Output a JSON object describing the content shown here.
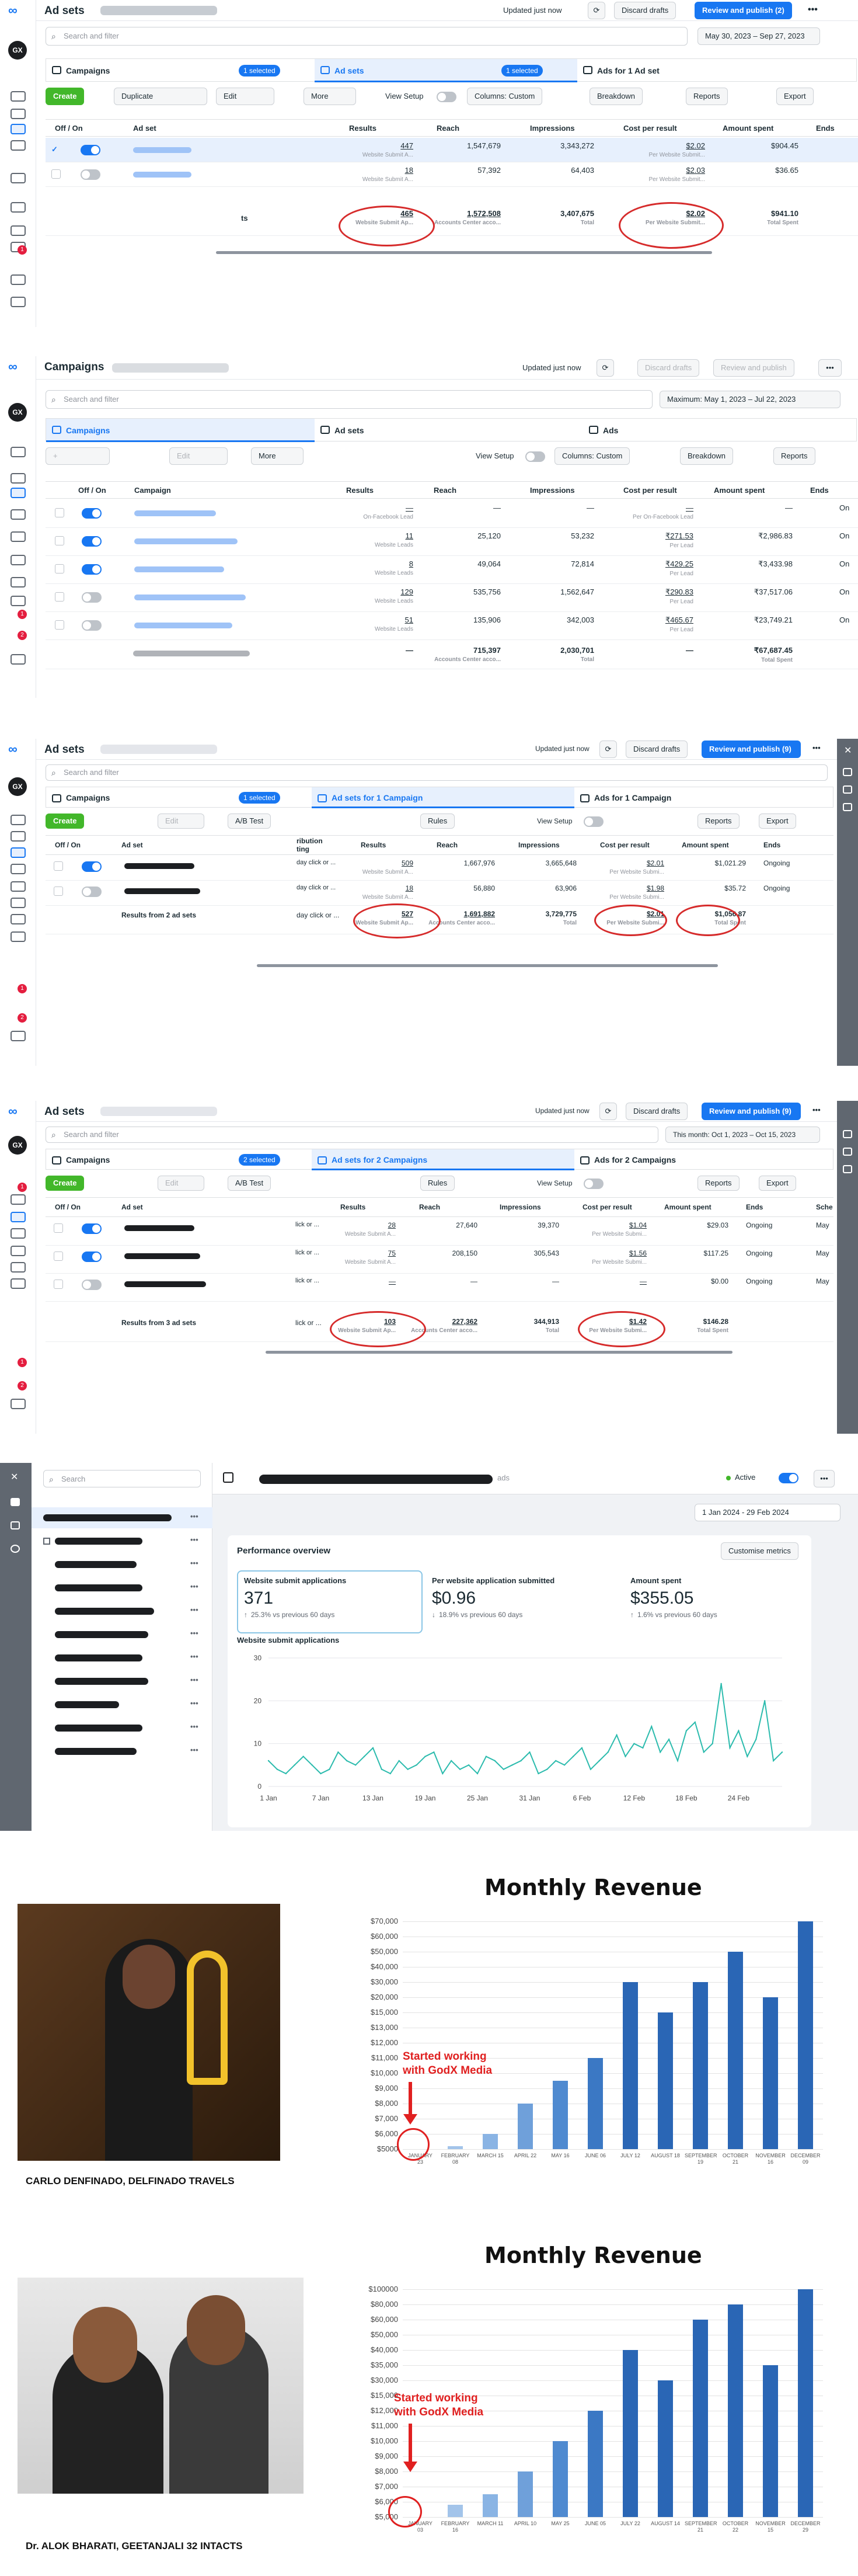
{
  "brand": {
    "accent": "#1877f2",
    "create_green": "#42b72a",
    "annotation_red": "#d62b2b",
    "chart_red": "#e02020"
  },
  "common": {
    "updated": "Updated just now",
    "discard": "Discard drafts",
    "search_placeholder": "Search and filter",
    "view_setup": "View Setup",
    "columns": "Columns: Custom",
    "breakdown": "Breakdown",
    "reports": "Reports",
    "export": "Export",
    "create": "Create",
    "edit": "Edit",
    "more": "More",
    "ab_test": "A/B Test",
    "rules": "Rules",
    "campaigns": "Campaigns",
    "gx": "GX",
    "header_offon": "Off / On",
    "header_adset": "Ad set",
    "header_campaign": "Campaign",
    "header_attribution": "ribution\nting",
    "header_results": "Results",
    "header_reach": "Reach",
    "header_impressions": "Impressions",
    "header_cpr": "Cost per result",
    "header_spent": "Amount spent",
    "header_ends": "Ends",
    "header_sche": "Sche"
  },
  "panel1": {
    "title": "Ad sets",
    "publish": "Review and publish (2)",
    "date": "May 30, 2023 – Sep 27, 2023",
    "selected": "1 selected",
    "tab_adsets": "Ad sets",
    "tab_ads": "Ads for 1 Ad set",
    "duplicate": "Duplicate",
    "rows": [
      {
        "results": "447",
        "results_sub": "Website Submit A...",
        "reach": "1,547,679",
        "impressions": "3,343,272",
        "cpr": "$2.02",
        "cpr_sub": "Per Website Submit...",
        "spent": "$904.45"
      },
      {
        "results": "18",
        "results_sub": "Website Submit A...",
        "reach": "57,392",
        "impressions": "64,403",
        "cpr": "$2.03",
        "cpr_sub": "Per Website Submit...",
        "spent": "$36.65"
      }
    ],
    "total": {
      "label": "ts",
      "results": "465",
      "results_sub": "Website Submit Ap...",
      "reach": "1,572,508",
      "reach_sub": "Accounts Center acco...",
      "impressions": "3,407,675",
      "impressions_sub": "Total",
      "cpr": "$2.02",
      "cpr_sub": "Per Website Submit...",
      "spent": "$941.10",
      "spent_sub": "Total Spent"
    }
  },
  "panel2": {
    "title": "Campaigns",
    "publish": "Review and publish",
    "date": "Maximum: May 1, 2023 – Jul 22, 2023",
    "tab_adsets": "Ad sets",
    "tab_ads": "Ads",
    "rows": [
      {
        "results": "—",
        "results_sub": "On-Facebook Lead",
        "reach": "—",
        "impressions": "—",
        "cpr": "—",
        "cpr_sub": "Per On-Facebook Lead",
        "spent": "—",
        "on": true
      },
      {
        "results": "11",
        "results_sub": "Website Leads",
        "reach": "25,120",
        "impressions": "53,232",
        "cpr": "₹271.53",
        "cpr_sub": "Per Lead",
        "spent": "₹2,986.83",
        "on": true
      },
      {
        "results": "8",
        "results_sub": "Website Leads",
        "reach": "49,064",
        "impressions": "72,814",
        "cpr": "₹429.25",
        "cpr_sub": "Per Lead",
        "spent": "₹3,433.98",
        "on": true
      },
      {
        "results": "129",
        "results_sub": "Website Leads",
        "reach": "535,756",
        "impressions": "1,562,647",
        "cpr": "₹290.83",
        "cpr_sub": "Per Lead",
        "spent": "₹37,517.06",
        "on": false
      },
      {
        "results": "51",
        "results_sub": "Website Leads",
        "reach": "135,906",
        "impressions": "342,003",
        "cpr": "₹465.67",
        "cpr_sub": "Per Lead",
        "spent": "₹23,749.21",
        "on": false
      }
    ],
    "ends_col": "On",
    "total": {
      "results": "—",
      "reach": "715,397",
      "reach_sub": "Accounts Center acco...",
      "impressions": "2,030,701",
      "impressions_sub": "Total",
      "cpr": "—",
      "spent": "₹67,687.45",
      "spent_sub": "Total Spent"
    }
  },
  "panel3": {
    "title": "Ad sets",
    "publish": "Review and publish (9)",
    "selected": "1 selected",
    "tab_adsets": "Ad sets for 1 Campaign",
    "tab_ads": "Ads for 1 Campaign",
    "rows": [
      {
        "attr": "day click or ...",
        "results": "509",
        "results_sub": "Website Submit A...",
        "reach": "1,667,976",
        "impressions": "3,665,648",
        "cpr": "$2.01",
        "cpr_sub": "Per Website Submi...",
        "spent": "$1,021.29",
        "ends": "Ongoing"
      },
      {
        "attr": "day click or ...",
        "results": "18",
        "results_sub": "Website Submit A...",
        "reach": "56,880",
        "impressions": "63,906",
        "cpr": "$1.98",
        "cpr_sub": "Per Website Submi...",
        "spent": "$35.72",
        "ends": "Ongoing"
      }
    ],
    "total": {
      "label": "Results from 2 ad sets",
      "attr": "day click or ...",
      "results": "527",
      "results_sub": "Website Submit Ap...",
      "reach": "1,691,882",
      "reach_sub": "Accounts Center acco...",
      "impressions": "3,729,775",
      "impressions_sub": "Total",
      "cpr": "$2.01",
      "cpr_sub": "Per Website Submi...",
      "spent": "$1,056.87",
      "spent_sub": "Total Spent"
    }
  },
  "panel4": {
    "title": "Ad sets",
    "publish": "Review and publish (9)",
    "date": "This month: Oct 1, 2023 – Oct 15, 2023",
    "selected": "2 selected",
    "tab_adsets": "Ad sets for 2 Campaigns",
    "tab_ads": "Ads for 2 Campaigns",
    "rows": [
      {
        "attr": "lick or ...",
        "results": "28",
        "results_sub": "Website Submit A...",
        "reach": "27,640",
        "impressions": "39,370",
        "cpr": "$1.04",
        "cpr_sub": "Per Website Submi...",
        "spent": "$29.03",
        "ends": "Ongoing",
        "sche": "May"
      },
      {
        "attr": "lick or ...",
        "results": "75",
        "results_sub": "Website Submit A...",
        "reach": "208,150",
        "impressions": "305,543",
        "cpr": "$1.56",
        "cpr_sub": "Per Website Submi...",
        "spent": "$117.25",
        "ends": "Ongoing",
        "sche": "May"
      },
      {
        "attr": "lick or ...",
        "results": "—",
        "results_sub": "",
        "reach": "—",
        "impressions": "—",
        "cpr": "—",
        "cpr_sub": "",
        "spent": "$0.00",
        "ends": "Ongoing",
        "sche": "May"
      }
    ],
    "total": {
      "label": "Results from 3 ad sets",
      "attr": "lick or ...",
      "results": "103",
      "results_sub": "Website Submit Ap...",
      "reach": "227,362",
      "reach_sub": "Accounts Center acco...",
      "impressions": "344,913",
      "impressions_sub": "Total",
      "cpr": "$1.42",
      "cpr_sub": "Per Website Submi...",
      "spent": "$146.28",
      "spent_sub": "Total Spent"
    }
  },
  "panel5": {
    "search": "Search",
    "status": "Active",
    "suffix": "ads",
    "date": "1 Jan 2024 - 29 Feb 2024",
    "perf_title": "Performance overview",
    "customise": "Customise metrics",
    "metrics": [
      {
        "label": "Website submit applications",
        "value": "371",
        "delta": "25.3% vs previous 60 days",
        "arrow": "↑"
      },
      {
        "label": "Per website application submitted",
        "value": "$0.96",
        "delta": "18.9% vs previous 60 days",
        "arrow": "↓"
      },
      {
        "label": "Amount spent",
        "value": "$355.05",
        "delta": "1.6% vs previous 60 days",
        "arrow": "↑"
      }
    ],
    "chart_title": "Website submit applications"
  },
  "revenue1": {
    "title": "Monthly Revenue",
    "caption": "CARLO DENFINADO, DELFINADO TRAVELS",
    "annotation": "Started working\nwith GodX Media"
  },
  "revenue2": {
    "title": "Monthly Revenue",
    "caption": "Dr. ALOK BHARATI, GEETANJALI 32 INTACTS",
    "annotation": "Started working\nwith GodX Media"
  },
  "chart_data": [
    {
      "type": "line",
      "title": "Website submit applications",
      "x": [
        "1 Jan",
        "2 Jan",
        "3 Jan",
        "4 Jan",
        "5 Jan",
        "6 Jan",
        "7 Jan",
        "8 Jan",
        "9 Jan",
        "10 Jan",
        "11 Jan",
        "12 Jan",
        "13 Jan",
        "14 Jan",
        "15 Jan",
        "16 Jan",
        "17 Jan",
        "18 Jan",
        "19 Jan",
        "20 Jan",
        "21 Jan",
        "22 Jan",
        "23 Jan",
        "24 Jan",
        "25 Jan",
        "26 Jan",
        "27 Jan",
        "28 Jan",
        "29 Jan",
        "30 Jan",
        "31 Jan",
        "1 Feb",
        "2 Feb",
        "3 Feb",
        "4 Feb",
        "5 Feb",
        "6 Feb",
        "7 Feb",
        "8 Feb",
        "9 Feb",
        "10 Feb",
        "11 Feb",
        "12 Feb",
        "13 Feb",
        "14 Feb",
        "15 Feb",
        "16 Feb",
        "17 Feb",
        "18 Feb",
        "19 Feb",
        "20 Feb",
        "21 Feb",
        "22 Feb",
        "23 Feb",
        "24 Feb",
        "25 Feb",
        "26 Feb",
        "27 Feb",
        "28 Feb",
        "29 Feb"
      ],
      "values": [
        6,
        4,
        3,
        5,
        7,
        5,
        3,
        4,
        8,
        6,
        5,
        7,
        9,
        4,
        3,
        6,
        4,
        5,
        7,
        8,
        3,
        6,
        4,
        5,
        3,
        7,
        6,
        4,
        5,
        6,
        8,
        3,
        4,
        6,
        5,
        7,
        9,
        4,
        6,
        8,
        12,
        7,
        10,
        9,
        14,
        8,
        11,
        6,
        13,
        15,
        8,
        10,
        24,
        9,
        13,
        7,
        11,
        20,
        6,
        8
      ],
      "xticks": [
        "1 Jan",
        "7 Jan",
        "13 Jan",
        "19 Jan",
        "25 Jan",
        "31 Jan",
        "6 Feb",
        "12 Feb",
        "18 Feb",
        "24 Feb"
      ],
      "yticks": [
        0,
        10,
        20,
        30
      ],
      "ylim": [
        0,
        30
      ],
      "color": "#2bbbad"
    },
    {
      "type": "bar",
      "title": "Monthly Revenue",
      "categories": [
        "JANUARY 23",
        "FEBRUARY 08",
        "MARCH 15",
        "APRIL 22",
        "MAY 16",
        "JUNE 06",
        "JULY 12",
        "AUGUST 18",
        "SEPTEMBER 19",
        "OCTOBER 21",
        "NOVEMBER 16",
        "DECEMBER 09"
      ],
      "values": [
        5000,
        5200,
        6000,
        8000,
        9500,
        11000,
        30000,
        15000,
        30000,
        50000,
        20000,
        70000
      ],
      "yticks": [
        "$5000",
        "$6,000",
        "$7,000",
        "$8,000",
        "$9,000",
        "$10,000",
        "$11,000",
        "$12,000",
        "$13,000",
        "$15,000",
        "$20,000",
        "$30,000",
        "$40,000",
        "$50,000",
        "$60,000",
        "$70,000"
      ]
    },
    {
      "type": "bar",
      "title": "Monthly Revenue",
      "categories": [
        "JANUARY 03",
        "FEBRUARY 16",
        "MARCH 11",
        "APRIL 10",
        "MAY 25",
        "JUNE 05",
        "JULY 22",
        "AUGUST 14",
        "SEPTEMBER 21",
        "OCTOBER 22",
        "NOVEMBER 15",
        "DECEMBER 29"
      ],
      "values": [
        5000,
        5800,
        6500,
        8000,
        10000,
        12000,
        40000,
        30000,
        60000,
        80000,
        35000,
        100000
      ],
      "yticks": [
        "$5,000",
        "$6,000",
        "$7,000",
        "$8,000",
        "$9,000",
        "$10,000",
        "$11,000",
        "$12,000",
        "$15,000",
        "$30,000",
        "$35,000",
        "$40,000",
        "$50,000",
        "$60,000",
        "$80,000",
        "$100000"
      ]
    }
  ]
}
